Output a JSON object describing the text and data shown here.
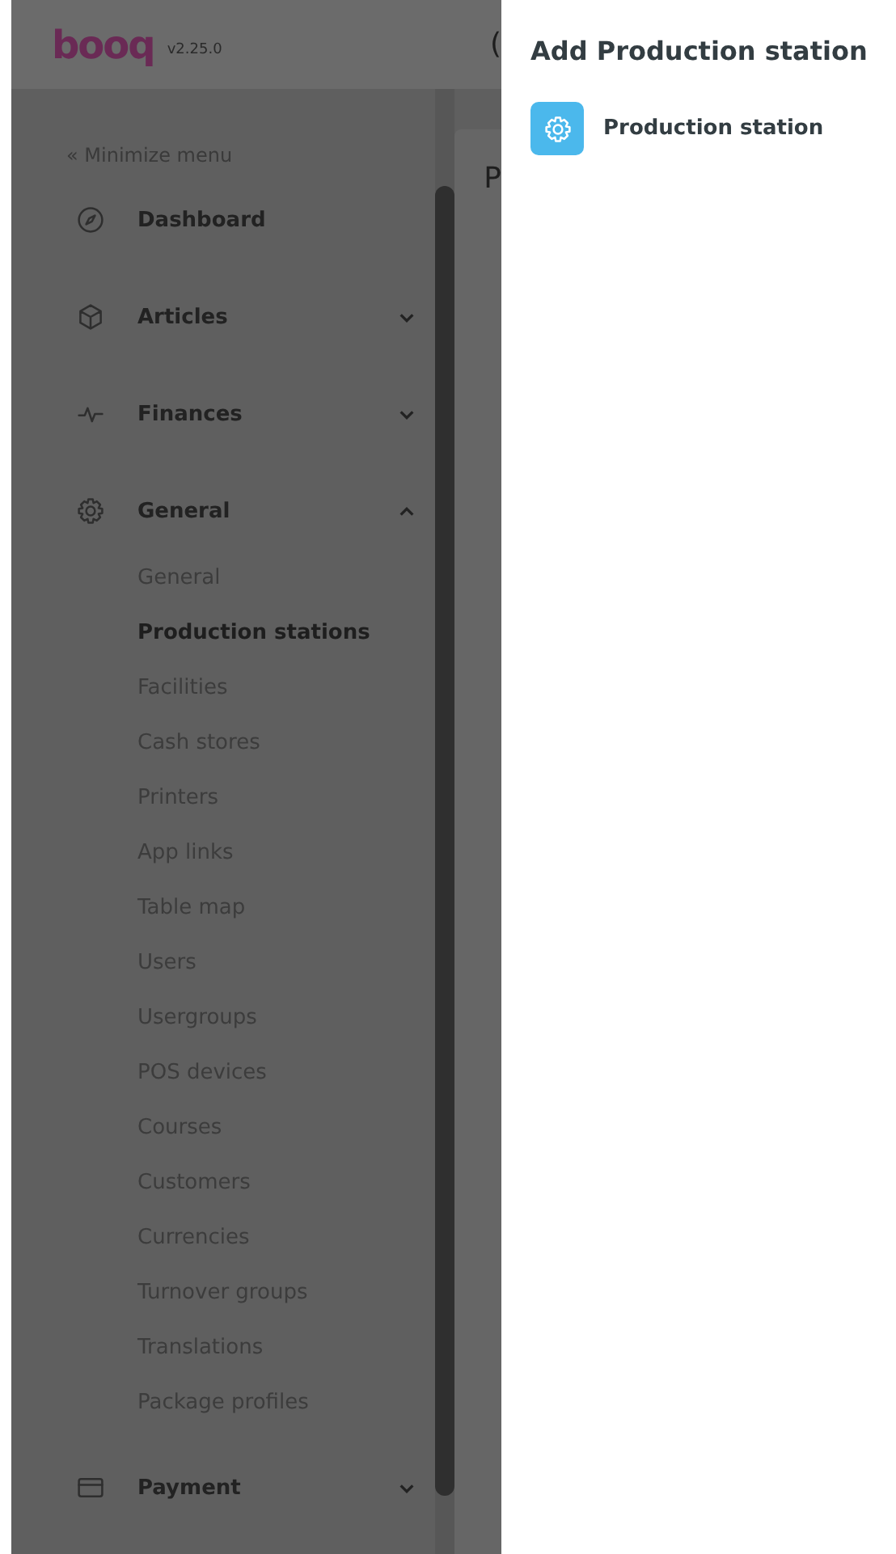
{
  "header": {
    "logo": "booq",
    "version": "v2.25.0",
    "cut_text": "("
  },
  "sidebar": {
    "minimize": "« Minimize menu",
    "items": [
      {
        "label": "Dashboard"
      },
      {
        "label": "Articles",
        "expanded": false
      },
      {
        "label": "Finances",
        "expanded": false
      },
      {
        "label": "General",
        "expanded": true,
        "children": [
          {
            "label": "General",
            "selected": false
          },
          {
            "label": "Production stations",
            "selected": true
          },
          {
            "label": "Facilities",
            "selected": false
          },
          {
            "label": "Cash stores",
            "selected": false
          },
          {
            "label": "Printers",
            "selected": false
          },
          {
            "label": "App links",
            "selected": false
          },
          {
            "label": "Table map",
            "selected": false
          },
          {
            "label": "Users",
            "selected": false
          },
          {
            "label": "Usergroups",
            "selected": false
          },
          {
            "label": "POS devices",
            "selected": false
          },
          {
            "label": "Courses",
            "selected": false
          },
          {
            "label": "Customers",
            "selected": false
          },
          {
            "label": "Currencies",
            "selected": false
          },
          {
            "label": "Turnover groups",
            "selected": false
          },
          {
            "label": "Translations",
            "selected": false
          },
          {
            "label": "Package profiles",
            "selected": false
          }
        ]
      },
      {
        "label": "Payment",
        "expanded": false
      }
    ]
  },
  "main": {
    "cut_title": "P"
  },
  "panel": {
    "title": "Add Production station",
    "options": [
      {
        "label": "Production station"
      }
    ]
  }
}
